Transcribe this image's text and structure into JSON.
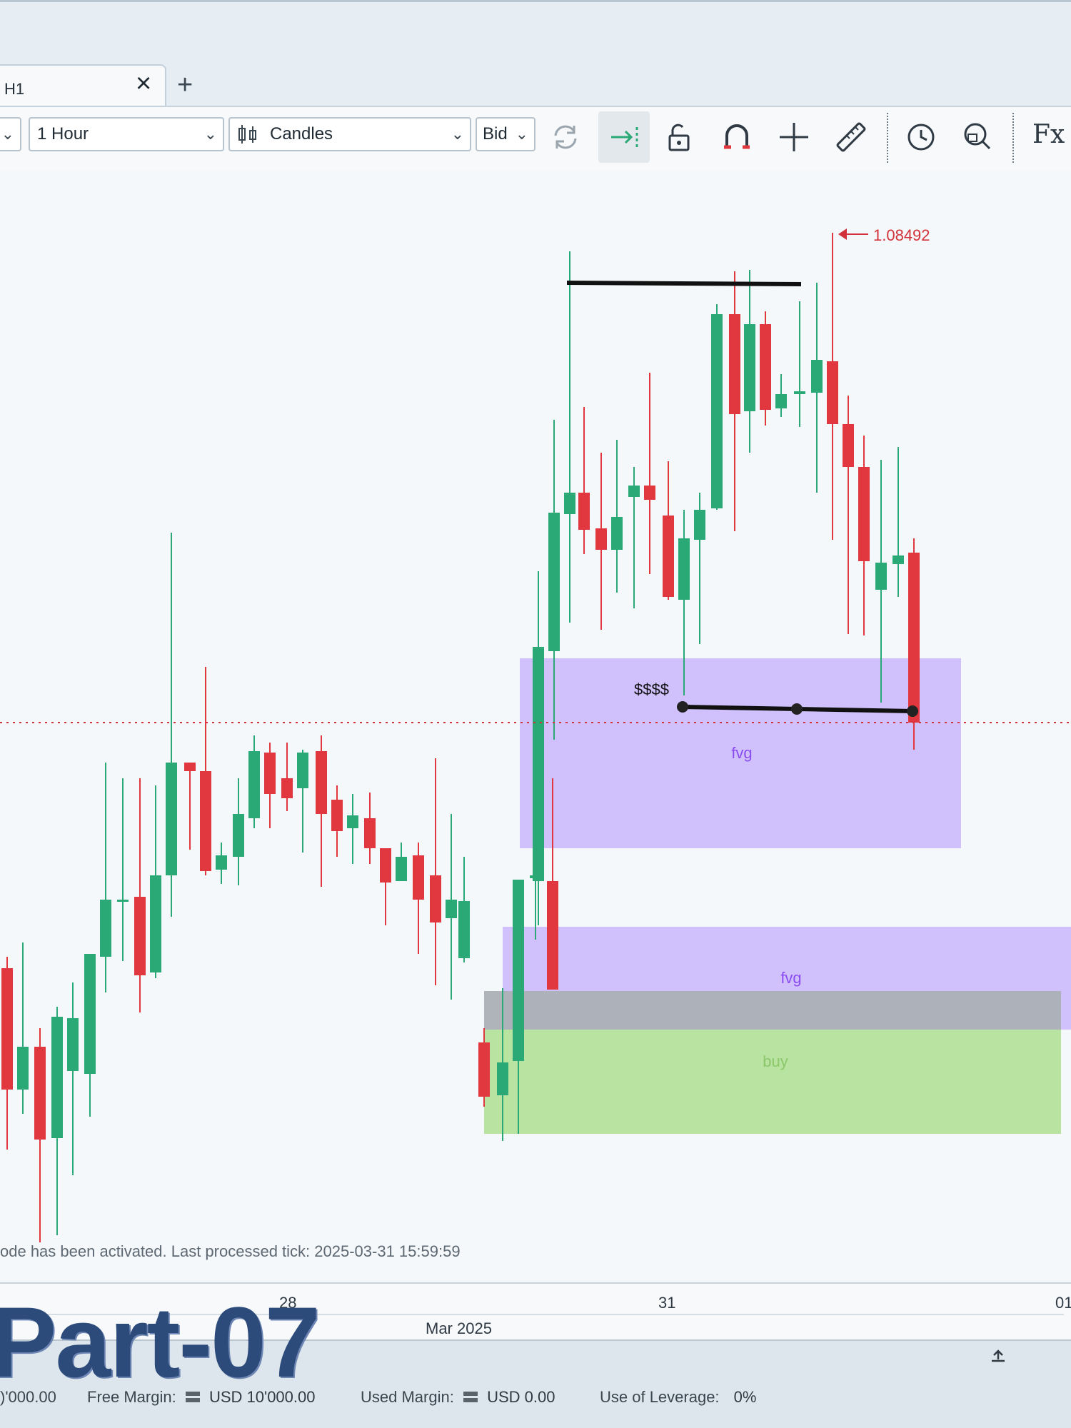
{
  "tab": {
    "label": "H1",
    "close_icon": "close-icon",
    "add_icon": "plus-icon"
  },
  "toolbar": {
    "timeframe": "1 Hour",
    "chart_type": "Candles",
    "price_side": "Bid",
    "icons": [
      "refresh-icon",
      "shift-chart-icon",
      "unlock-icon",
      "magnet-icon",
      "crosshair-icon",
      "ruler-icon",
      "clock-icon",
      "zoom-icon",
      "indicators-icon"
    ],
    "indicators_label": "Fx"
  },
  "chart": {
    "price_label": "1.08492",
    "liquidity_label": "$$$$",
    "zones": [
      {
        "label": "fvg",
        "color": "#c9b6fb"
      },
      {
        "label": "fvg",
        "color": "#c9b6fb"
      },
      {
        "label": "buy",
        "color": "#b4e29c"
      }
    ],
    "colors": {
      "bull": "#2aa876",
      "bear": "#e0383e",
      "price_line": "#d2333a"
    }
  },
  "status": {
    "message": "ode has been activated. Last processed tick: 2025-03-31 15:59:59"
  },
  "axis": {
    "dates": [
      {
        "label": "28"
      },
      {
        "label": "31"
      },
      {
        "label": "01"
      }
    ],
    "month": "Mar 2025"
  },
  "footer": {
    "balance_value": ")'000.00",
    "free_margin_label": "Free Margin:",
    "free_margin_value": "USD 10'000.00",
    "used_margin_label": "Used Margin:",
    "used_margin_value": "USD 0.00",
    "leverage_label": "Use of Leverage:",
    "leverage_value": "0%"
  },
  "watermark": "Part-07"
}
